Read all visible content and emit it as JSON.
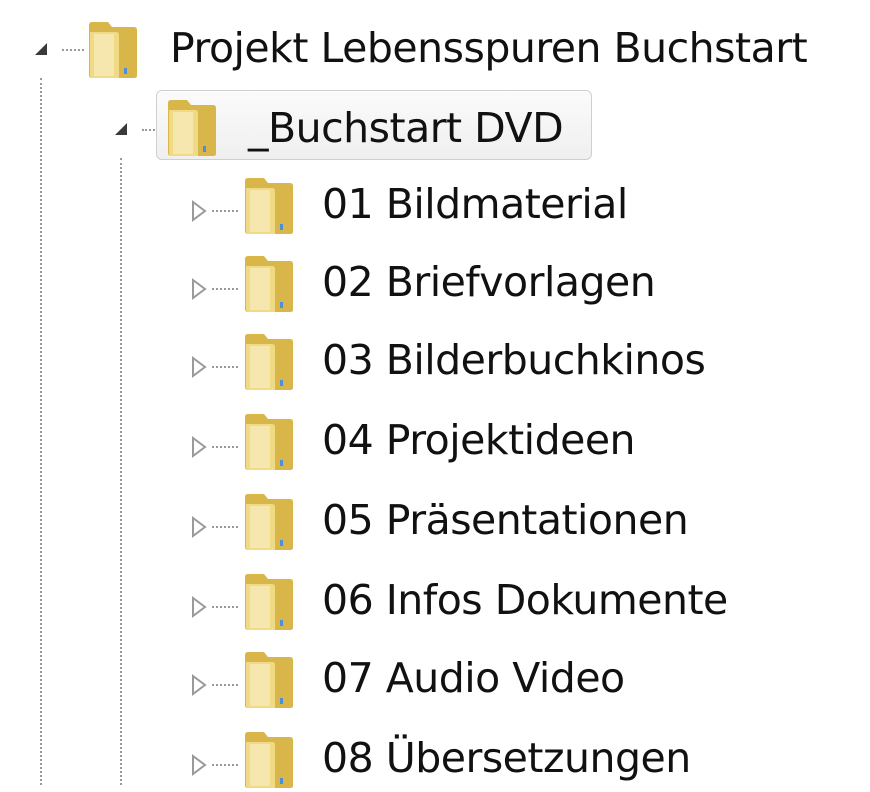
{
  "tree": {
    "root": {
      "label": "Projekt Lebensspuren Buchstart",
      "expanded": true,
      "icon": "folder-icon"
    },
    "child": {
      "label": "_Buchstart DVD",
      "expanded": true,
      "selected": true,
      "icon": "folder-icon"
    },
    "items": [
      {
        "label": "01 Bildmaterial",
        "expanded": false,
        "icon": "folder-icon"
      },
      {
        "label": "02 Briefvorlagen",
        "expanded": false,
        "icon": "folder-icon"
      },
      {
        "label": "03 Bilderbuchkinos",
        "expanded": false,
        "icon": "folder-icon"
      },
      {
        "label": "04 Projektideen",
        "expanded": false,
        "icon": "folder-icon"
      },
      {
        "label": "05 Präsentationen",
        "expanded": false,
        "icon": "folder-icon"
      },
      {
        "label": "06 Infos Dokumente",
        "expanded": false,
        "icon": "folder-icon"
      },
      {
        "label": "07 Audio Video",
        "expanded": false,
        "icon": "folder-icon"
      },
      {
        "label": "08 Übersetzungen",
        "expanded": false,
        "icon": "folder-icon"
      }
    ]
  },
  "colors": {
    "folder_back": "#d9b64a",
    "folder_front": "#f2dc87",
    "connector": "#9a9a9a",
    "selection_border": "#cfcfcf",
    "text": "#111111"
  }
}
